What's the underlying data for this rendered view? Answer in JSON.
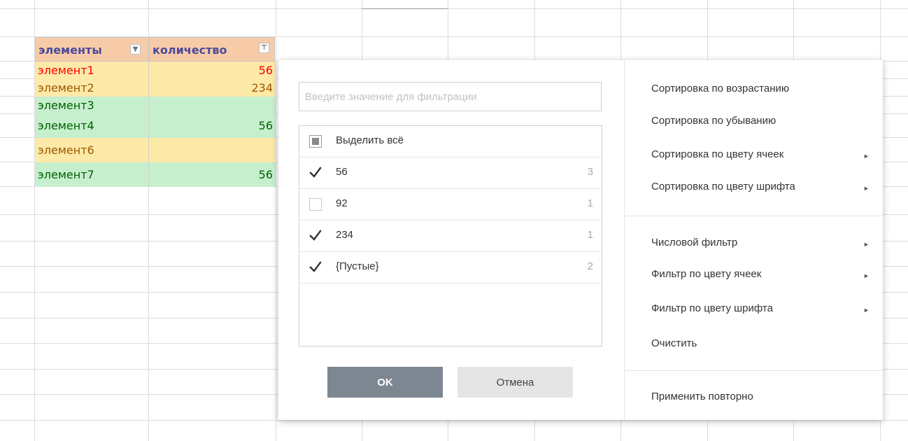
{
  "sheet": {
    "header": {
      "col_a": "элементы",
      "col_b": "количество",
      "filter_a_glyph": "▼",
      "filter_b_glyph": "⊤"
    },
    "rows": [
      {
        "name": "элемент1",
        "qty": "56",
        "color": "#ff0000",
        "bg": "#fde9a8"
      },
      {
        "name": "элемент2",
        "qty": "234",
        "color": "#9c5700",
        "bg": "#fde9a8"
      },
      {
        "name": "элемент3",
        "qty": "",
        "color": "#006100",
        "bg": "#c6efce"
      },
      {
        "name": "элемент4",
        "qty": "56",
        "color": "#006100",
        "bg": "#c6efce"
      },
      {
        "name": "элемент6",
        "qty": "",
        "color": "#9c5700",
        "bg": "#fde9a8"
      },
      {
        "name": "элемент7",
        "qty": "56",
        "color": "#006100",
        "bg": "#c6efce"
      }
    ]
  },
  "filter": {
    "search_placeholder": "Введите значение для фильтрации",
    "select_all": "Выделить всё",
    "values": [
      {
        "label": "56",
        "count": "3",
        "state": "checked"
      },
      {
        "label": "92",
        "count": "1",
        "state": "none"
      },
      {
        "label": "234",
        "count": "1",
        "state": "checked"
      },
      {
        "label": "{Пустые}",
        "count": "2",
        "state": "checked"
      }
    ],
    "ok": "OK",
    "cancel": "Отмена"
  },
  "menu": {
    "sort_asc": "Сортировка по возрастанию",
    "sort_desc": "Сортировка по убыванию",
    "sort_cell_color": "Сортировка по цвету ячеек",
    "sort_font_color": "Сортировка по цвету шрифта",
    "number_filter": "Числовой фильтр",
    "filter_cell_color": "Фильтр по цвету ячеек",
    "filter_font_color": "Фильтр по цвету шрифта",
    "clear": "Очистить",
    "reapply": "Применить повторно",
    "arrow": "►"
  },
  "colors": {
    "grid_line": "#d9d9d9",
    "header_bg": "#f8cba8",
    "header_text": "#4a4a9a",
    "ok_bg": "#7c8791"
  }
}
